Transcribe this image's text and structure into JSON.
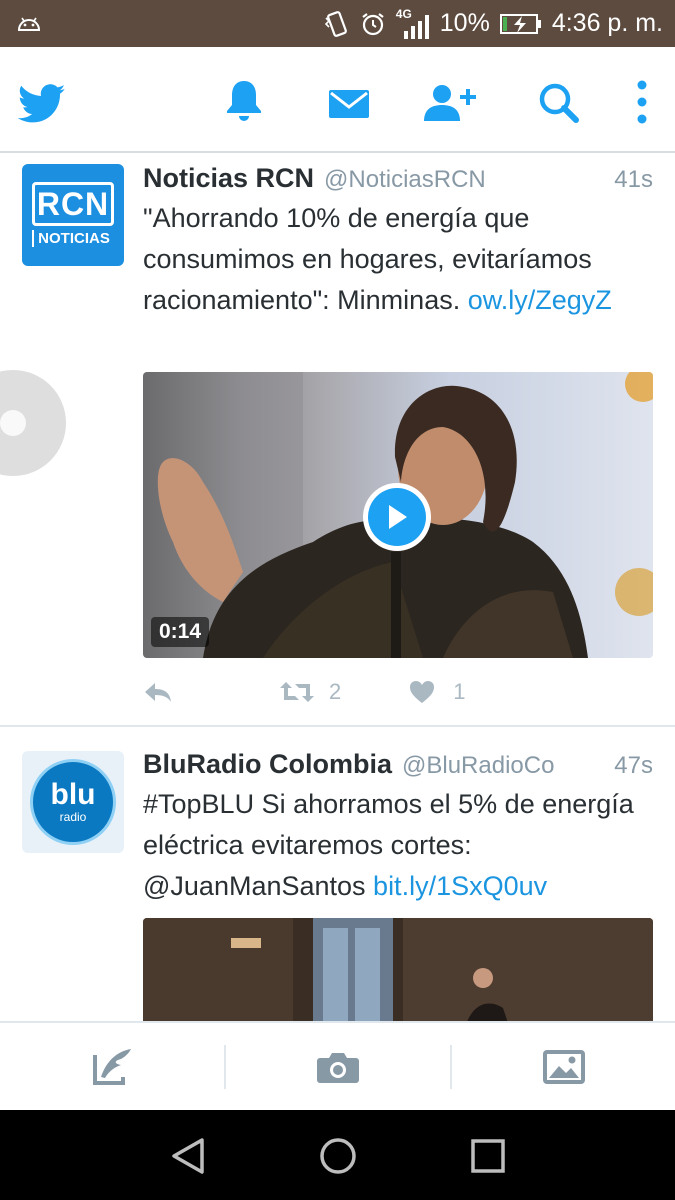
{
  "status_bar": {
    "network": "4G",
    "battery": "10%",
    "time": "4:36 p. m."
  },
  "tweets": [
    {
      "name": "Noticias RCN",
      "handle": "@NoticiasRCN",
      "time": "41s",
      "text": "\"Ahorrando 10% de energía que consumimos en hogares, evitaríamos racionamiento\": Minminas. ",
      "link": "ow.ly/ZegyZ",
      "avatar_brand": "RCN",
      "avatar_label": "NOTICIAS",
      "video_duration": "0:14",
      "retweets": "2",
      "likes": "1"
    },
    {
      "name": "BluRadio Colombia",
      "handle": "@BluRadioCo",
      "time": "47s",
      "text": "#TopBLU Si ahorramos el 5% de energía eléctrica evitaremos cortes: @JuanManSantos ",
      "link": "bit.ly/1SxQ0uv",
      "avatar_brand": "blu",
      "avatar_label": "radio"
    }
  ],
  "colors": {
    "twitter_blue": "#1da1f2",
    "link": "#1b95e0",
    "status_bar": "#5d4b3f"
  }
}
